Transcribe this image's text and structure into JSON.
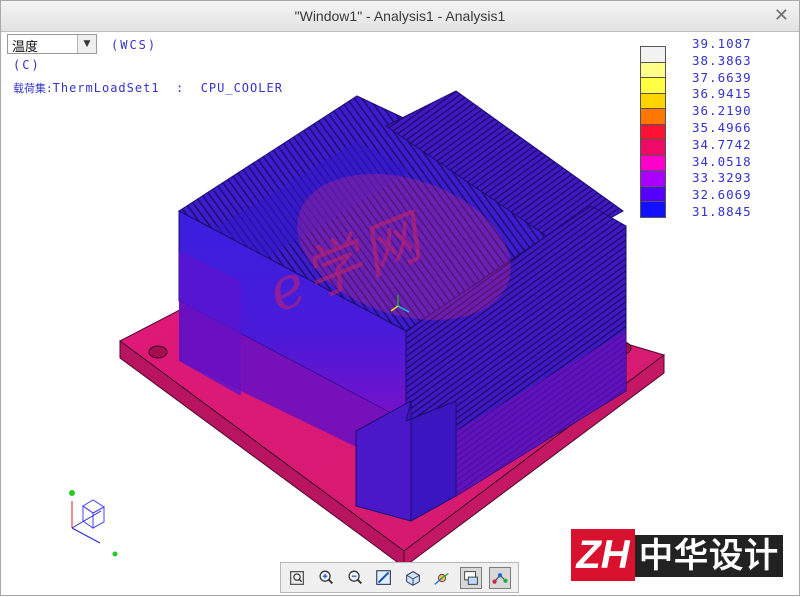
{
  "window": {
    "title": "\"Window1\" - Analysis1 - Analysis1"
  },
  "quantity": {
    "selected": "温度",
    "options": [
      "温度"
    ]
  },
  "coord_system": "(WCS)",
  "unit": "(C)",
  "load_set": {
    "label": "载荷集:",
    "name": "ThermLoadSet1",
    "separator": ":",
    "model": "CPU_COOLER"
  },
  "legend": [
    {
      "value": "39.1087",
      "color": "#f2f2f2"
    },
    {
      "value": "38.3863",
      "color": "#ffff88"
    },
    {
      "value": "37.6639",
      "color": "#ffff44"
    },
    {
      "value": "36.9415",
      "color": "#ffd400"
    },
    {
      "value": "36.2190",
      "color": "#ff7700"
    },
    {
      "value": "35.4966",
      "color": "#ff1133"
    },
    {
      "value": "34.7742",
      "color": "#ee0a66"
    },
    {
      "value": "34.0518",
      "color": "#ff00cc"
    },
    {
      "value": "33.3293",
      "color": "#aa00ff"
    },
    {
      "value": "32.6069",
      "color": "#5500ff"
    },
    {
      "value": "31.8845",
      "color": "#1111ff"
    }
  ],
  "watermark": {
    "text": "e学网",
    "color": "#cc2266"
  },
  "logo": {
    "text": "中华设计",
    "prefix": "ZH"
  },
  "toolbar": [
    {
      "name": "refit-icon",
      "active": false
    },
    {
      "name": "zoom-in-icon",
      "active": false
    },
    {
      "name": "zoom-out-icon",
      "active": false
    },
    {
      "name": "repaint-icon",
      "active": false
    },
    {
      "name": "saved-views-icon",
      "active": false
    },
    {
      "name": "spin-center-icon",
      "active": false
    },
    {
      "name": "display-style-icon",
      "active": true
    },
    {
      "name": "datum-display-icon",
      "active": true
    }
  ]
}
